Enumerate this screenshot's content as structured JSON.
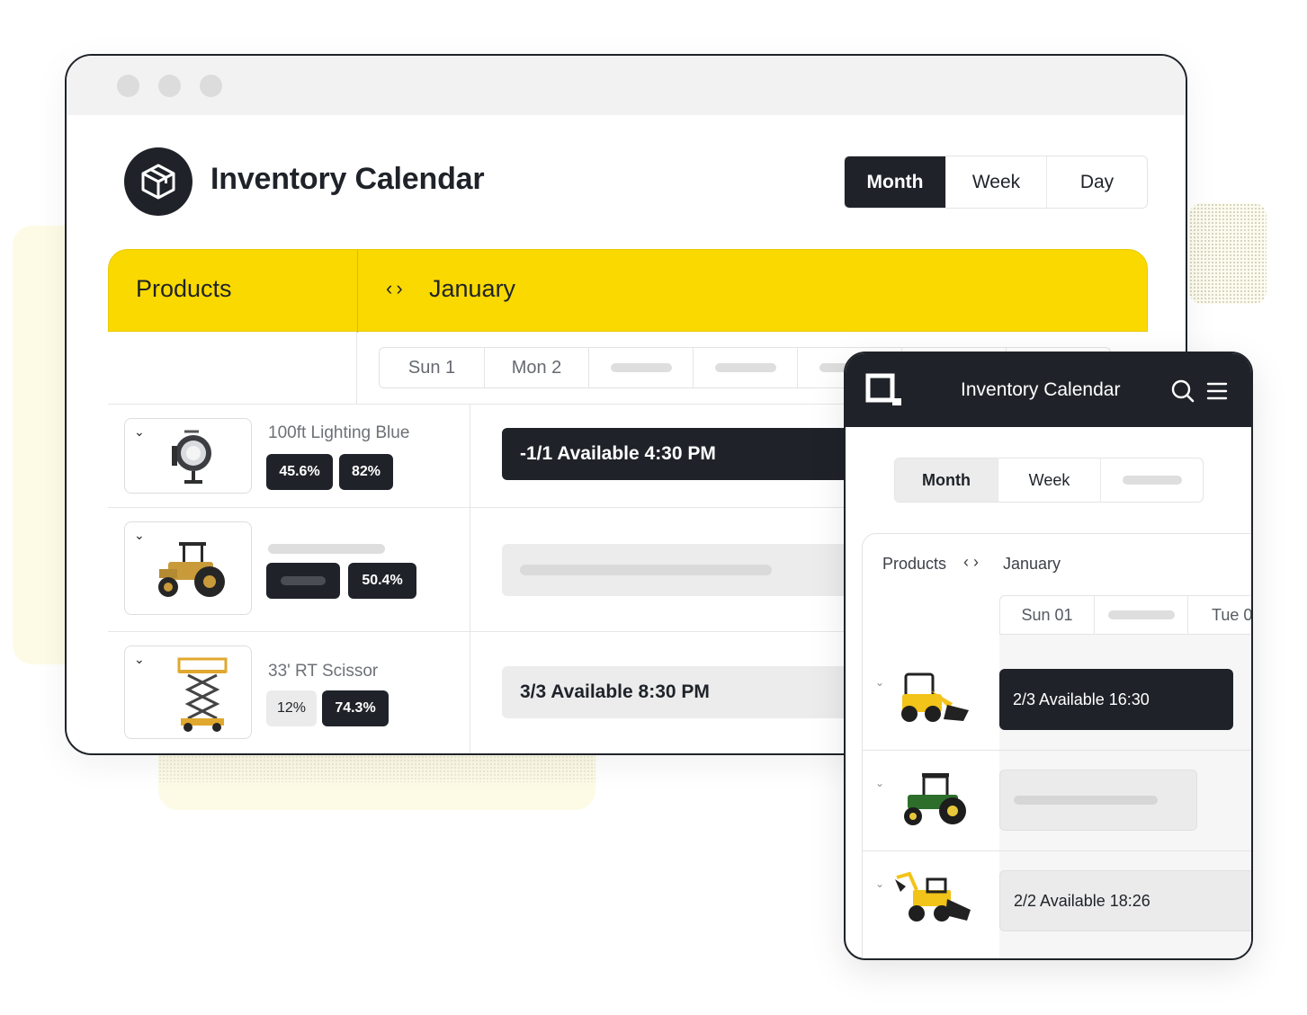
{
  "desktop": {
    "app_title": "Inventory Calendar",
    "view_options": [
      "Month",
      "Week",
      "Day"
    ],
    "active_view": "Month",
    "header": {
      "products_label": "Products",
      "month": "January"
    },
    "days": [
      "Sun 1",
      "Mon 2"
    ],
    "products": [
      {
        "name": "100ft Lighting Blue",
        "badges": [
          "45.6%",
          "82%"
        ],
        "event": "-1/1 Available 4:30 PM",
        "event_style": "dark",
        "icon": "spotlight-icon"
      },
      {
        "name": "",
        "badges": [
          "",
          "50.4%"
        ],
        "event": "",
        "event_style": "light",
        "icon": "tractor-icon"
      },
      {
        "name": "33' RT Scissor",
        "badges": [
          "12%",
          "74.3%"
        ],
        "event": "3/3 Available 8:30 PM",
        "event_style": "light",
        "icon": "scissor-lift-icon"
      }
    ]
  },
  "mobile": {
    "app_title": "Inventory Calendar",
    "view_options": [
      "Month",
      "Week",
      ""
    ],
    "active_view": "Month",
    "products_label": "Products",
    "month": "January",
    "days": [
      "Sun 01",
      "",
      "Tue 0"
    ],
    "rows": [
      {
        "event": "2/3 Available  16:30",
        "style": "dark",
        "icon": "skid-steer-icon"
      },
      {
        "event": "",
        "style": "light",
        "icon": "tractor-icon"
      },
      {
        "event": "2/2 Available  18:26",
        "style": "light",
        "icon": "backhoe-loader-icon"
      }
    ]
  },
  "colors": {
    "accent_yellow": "#fad900",
    "dark": "#1f2329"
  }
}
